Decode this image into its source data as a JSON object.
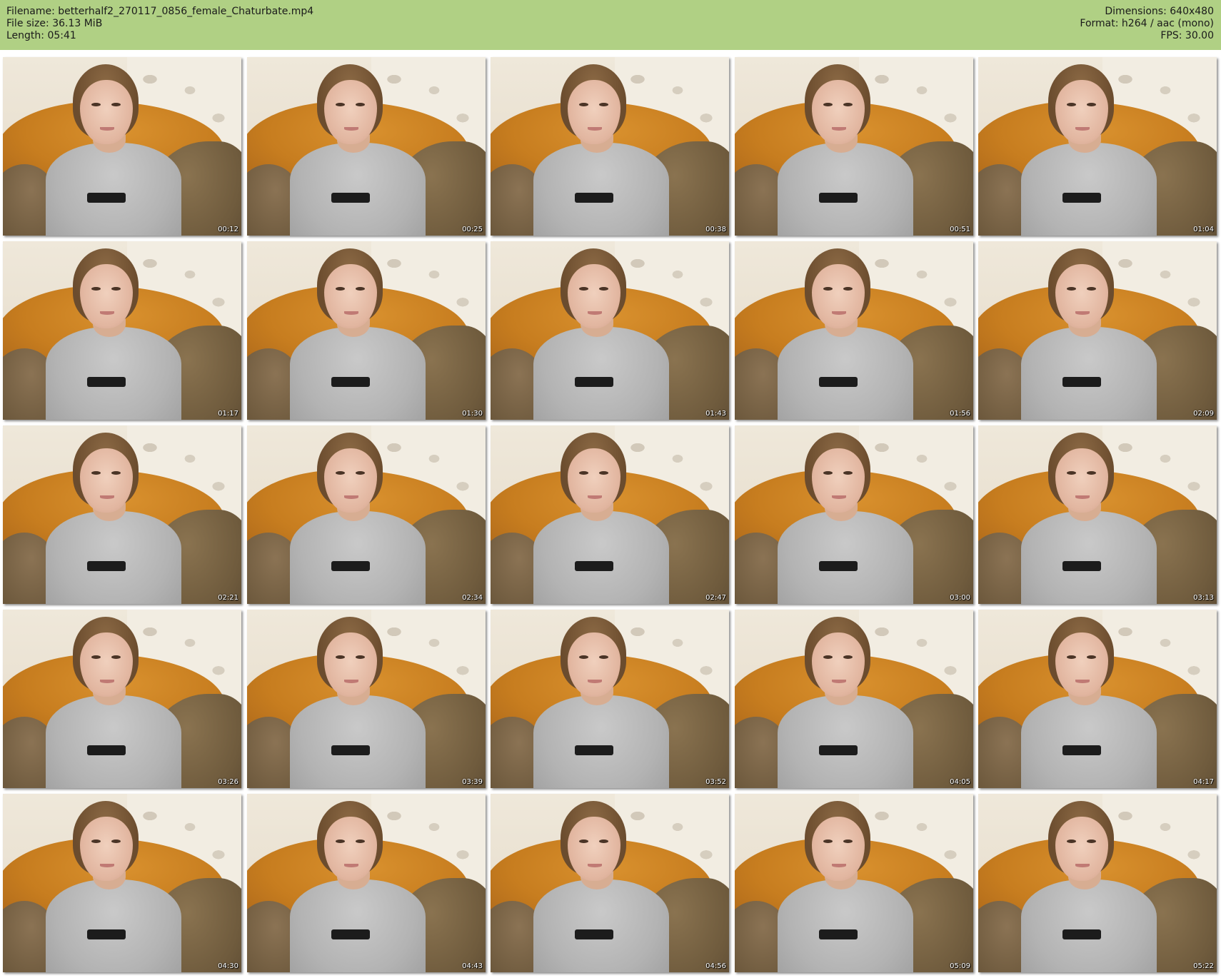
{
  "header": {
    "filename": "Filename: betterhalf2_270117_0856_female_Chaturbate.mp4",
    "filesize": "File size: 36.13 MiB",
    "length": "Length: 05:41",
    "dimensions": "Dimensions: 640x480",
    "format": "Format: h264 / aac (mono)",
    "fps": "FPS: 30.00"
  },
  "colors": {
    "header_bg": "#b0d084",
    "page_bg": "#ffffff",
    "timestamp_text": "#ffffff"
  },
  "thumbnails": [
    {
      "time": "00:12"
    },
    {
      "time": "00:25"
    },
    {
      "time": "00:38"
    },
    {
      "time": "00:51"
    },
    {
      "time": "01:04"
    },
    {
      "time": "01:17"
    },
    {
      "time": "01:30"
    },
    {
      "time": "01:43"
    },
    {
      "time": "01:56"
    },
    {
      "time": "02:09"
    },
    {
      "time": "02:21"
    },
    {
      "time": "02:34"
    },
    {
      "time": "02:47"
    },
    {
      "time": "03:00"
    },
    {
      "time": "03:13"
    },
    {
      "time": "03:26"
    },
    {
      "time": "03:39"
    },
    {
      "time": "03:52"
    },
    {
      "time": "04:05"
    },
    {
      "time": "04:17"
    },
    {
      "time": "04:30"
    },
    {
      "time": "04:43"
    },
    {
      "time": "04:56"
    },
    {
      "time": "05:09"
    },
    {
      "time": "05:22"
    }
  ]
}
